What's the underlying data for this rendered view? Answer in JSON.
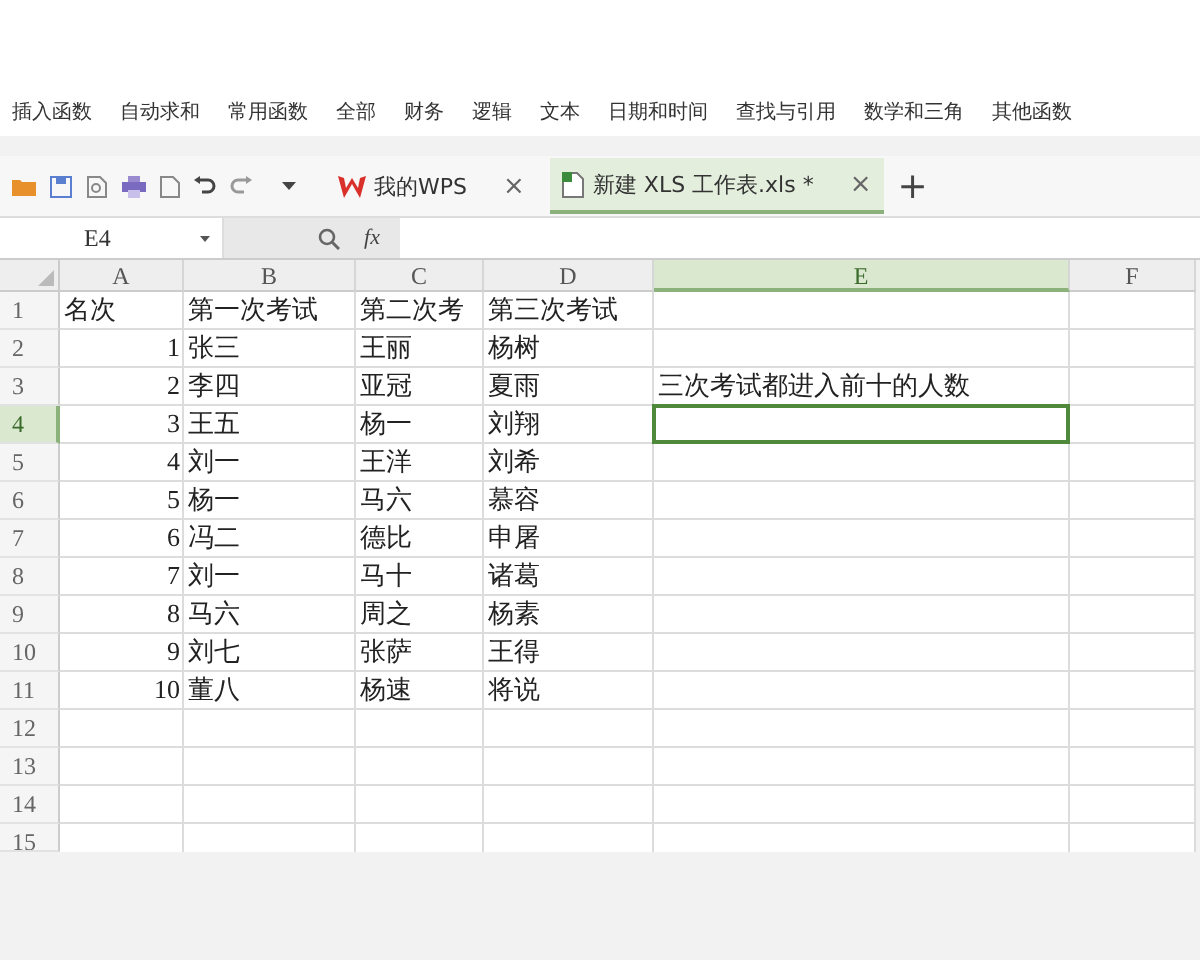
{
  "ribbon": {
    "items": [
      "插入函数",
      "自动求和",
      "常用函数",
      "全部",
      "财务",
      "逻辑",
      "文本",
      "日期和时间",
      "查找与引用",
      "数学和三角",
      "其他函数"
    ]
  },
  "toolbar": {
    "tabs": [
      {
        "label": "我的WPS",
        "kind": "home",
        "selected": false,
        "close": "×"
      },
      {
        "label": "新建 XLS 工作表.xls *",
        "kind": "sheet",
        "selected": true,
        "close": "×"
      }
    ],
    "new_tab": "+"
  },
  "formula_bar": {
    "cell_ref": "E4",
    "fx": "fx"
  },
  "sheet": {
    "columns": [
      {
        "label": "A",
        "selected": false
      },
      {
        "label": "B",
        "selected": false
      },
      {
        "label": "C",
        "selected": false
      },
      {
        "label": "D",
        "selected": false
      },
      {
        "label": "E",
        "selected": true
      },
      {
        "label": "F",
        "selected": false
      }
    ],
    "rows": [
      {
        "label": "1",
        "selected": false,
        "cells": [
          {
            "text": "名次"
          },
          {
            "text": "第一次考试"
          },
          {
            "text": "第二次考"
          },
          {
            "text": "第三次考试"
          }
        ]
      },
      {
        "label": "2",
        "selected": false,
        "cells": [
          {
            "text": "1",
            "numeric": true
          },
          {
            "text": "张三"
          },
          {
            "text": "王丽"
          },
          {
            "text": "杨树"
          }
        ]
      },
      {
        "label": "3",
        "selected": false,
        "cells": [
          {
            "text": "2",
            "numeric": true
          },
          {
            "text": "李四"
          },
          {
            "text": "亚冠"
          },
          {
            "text": "夏雨"
          },
          {
            "text": "三次考试都进入前十的人数"
          }
        ]
      },
      {
        "label": "4",
        "selected": true,
        "cells": [
          {
            "text": "3",
            "numeric": true
          },
          {
            "text": "王五"
          },
          {
            "text": "杨一"
          },
          {
            "text": "刘翔"
          },
          {
            "active": true
          }
        ]
      },
      {
        "label": "5",
        "selected": false,
        "cells": [
          {
            "text": "4",
            "numeric": true
          },
          {
            "text": "刘一"
          },
          {
            "text": "王洋"
          },
          {
            "text": "刘希"
          }
        ]
      },
      {
        "label": "6",
        "selected": false,
        "cells": [
          {
            "text": "5",
            "numeric": true
          },
          {
            "text": "杨一"
          },
          {
            "text": "马六"
          },
          {
            "text": "慕容"
          }
        ]
      },
      {
        "label": "7",
        "selected": false,
        "cells": [
          {
            "text": "6",
            "numeric": true
          },
          {
            "text": "冯二"
          },
          {
            "text": "德比"
          },
          {
            "text": "申屠"
          }
        ]
      },
      {
        "label": "8",
        "selected": false,
        "cells": [
          {
            "text": "7",
            "numeric": true
          },
          {
            "text": "刘一"
          },
          {
            "text": "马十"
          },
          {
            "text": "诸葛"
          }
        ]
      },
      {
        "label": "9",
        "selected": false,
        "cells": [
          {
            "text": "8",
            "numeric": true
          },
          {
            "text": "马六"
          },
          {
            "text": "周之"
          },
          {
            "text": "杨素"
          }
        ]
      },
      {
        "label": "10",
        "selected": false,
        "cells": [
          {
            "text": "9",
            "numeric": true
          },
          {
            "text": "刘七"
          },
          {
            "text": "张萨"
          },
          {
            "text": "王得"
          }
        ]
      },
      {
        "label": "11",
        "selected": false,
        "cells": [
          {
            "text": "10",
            "numeric": true
          },
          {
            "text": "董八"
          },
          {
            "text": "杨速"
          },
          {
            "text": "将说"
          }
        ]
      },
      {
        "label": "12",
        "selected": false
      },
      {
        "label": "13",
        "selected": false
      },
      {
        "label": "14",
        "selected": false
      },
      {
        "label": "15",
        "selected": false
      }
    ]
  }
}
